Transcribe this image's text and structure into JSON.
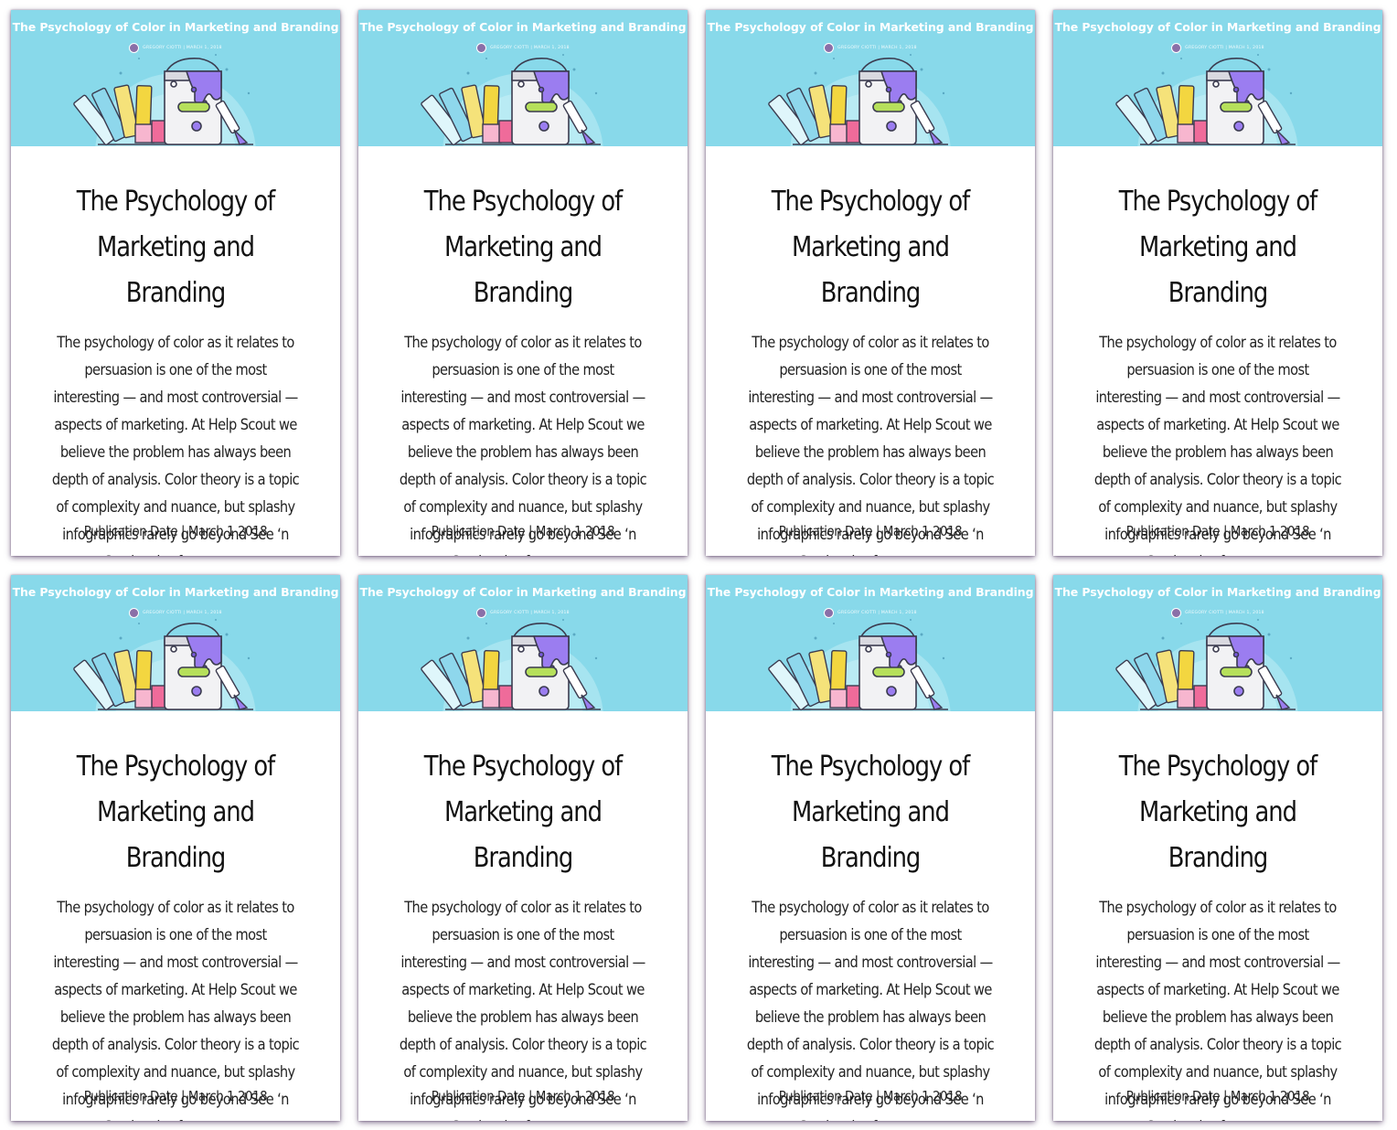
{
  "cards": [
    {
      "banner_title": "The Psychology of Color in Marketing and Branding",
      "banner_byline": "GREGORY CIOTTI  |  MARCH 1, 2018",
      "title": "The Psychology of Marketing and Branding",
      "description": "The psychology of color as it relates to persuasion is one of the most interesting — and most controversial — aspects of marketing. At Help Scout we believe the problem has always been depth of analysis. Color theory is a topic of complexity and nuance, but splashy infographics rarely go beyond See ‘n Say levels of coverage.",
      "date_label": "Publication Date | March 1 2018"
    },
    {
      "banner_title": "The Psychology of Color in Marketing and Branding",
      "banner_byline": "GREGORY CIOTTI  |  MARCH 1, 2018",
      "title": "The Psychology of Marketing and Branding",
      "description": "The psychology of color as it relates to persuasion is one of the most interesting — and most controversial — aspects of marketing. At Help Scout we believe the problem has always been depth of analysis. Color theory is a topic of complexity and nuance, but splashy infographics rarely go beyond See ‘n Say levels of coverage.",
      "date_label": "Publication Date | March 1 2018"
    },
    {
      "banner_title": "The Psychology of Color in Marketing and Branding",
      "banner_byline": "GREGORY CIOTTI  |  MARCH 1, 2018",
      "title": "The Psychology of Marketing and Branding",
      "description": "The psychology of color as it relates to persuasion is one of the most interesting — and most controversial — aspects of marketing. At Help Scout we believe the problem has always been depth of analysis. Color theory is a topic of complexity and nuance, but splashy infographics rarely go beyond See ‘n Say levels of coverage.",
      "date_label": "Publication Date | March 1 2018"
    },
    {
      "banner_title": "The Psychology of Color in Marketing and Branding",
      "banner_byline": "GREGORY CIOTTI  |  MARCH 1, 2018",
      "title": "The Psychology of Marketing and Branding",
      "description": "The psychology of color as it relates to persuasion is one of the most interesting — and most controversial — aspects of marketing. At Help Scout we believe the problem has always been depth of analysis. Color theory is a topic of complexity and nuance, but splashy infographics rarely go beyond See ‘n Say levels of coverage.",
      "date_label": "Publication Date | March 1 2018"
    },
    {
      "banner_title": "The Psychology of Color in Marketing and Branding",
      "banner_byline": "GREGORY CIOTTI  |  MARCH 1, 2018",
      "title": "The Psychology of Marketing and Branding",
      "description": "The psychology of color as it relates to persuasion is one of the most interesting — and most controversial — aspects of marketing. At Help Scout we believe the problem has always been depth of analysis. Color theory is a topic of complexity and nuance, but splashy infographics rarely go beyond See ‘n Say levels of coverage.",
      "date_label": "Publication Date | March 1 2018"
    },
    {
      "banner_title": "The Psychology of Color in Marketing and Branding",
      "banner_byline": "GREGORY CIOTTI  |  MARCH 1, 2018",
      "title": "The Psychology of Marketing and Branding",
      "description": "The psychology of color as it relates to persuasion is one of the most interesting — and most controversial — aspects of marketing. At Help Scout we believe the problem has always been depth of analysis. Color theory is a topic of complexity and nuance, but splashy infographics rarely go beyond See ‘n Say levels of coverage.",
      "date_label": "Publication Date | March 1 2018"
    },
    {
      "banner_title": "The Psychology of Color in Marketing and Branding",
      "banner_byline": "GREGORY CIOTTI  |  MARCH 1, 2018",
      "title": "The Psychology of Marketing and Branding",
      "description": "The psychology of color as it relates to persuasion is one of the most interesting — and most controversial — aspects of marketing. At Help Scout we believe the problem has always been depth of analysis. Color theory is a topic of complexity and nuance, but splashy infographics rarely go beyond See ‘n Say levels of coverage.",
      "date_label": "Publication Date | March 1 2018"
    },
    {
      "banner_title": "The Psychology of Color in Marketing and Branding",
      "banner_byline": "GREGORY CIOTTI  |  MARCH 1, 2018",
      "title": "The Psychology of Marketing and Branding",
      "description": "The psychology of color as it relates to persuasion is one of the most interesting — and most controversial — aspects of marketing. At Help Scout we believe the problem has always been depth of analysis. Color theory is a topic of complexity and nuance, but splashy infographics rarely go beyond See ‘n Say levels of coverage.",
      "date_label": "Publication Date | March 1 2018"
    }
  ],
  "theme": {
    "banner_color": "#88d9ea",
    "card_background": "#ffffff",
    "text_color": "#111111"
  },
  "icons": {
    "illustration": "paint-bucket-swatches-illustration",
    "avatar": "author-avatar-icon"
  }
}
